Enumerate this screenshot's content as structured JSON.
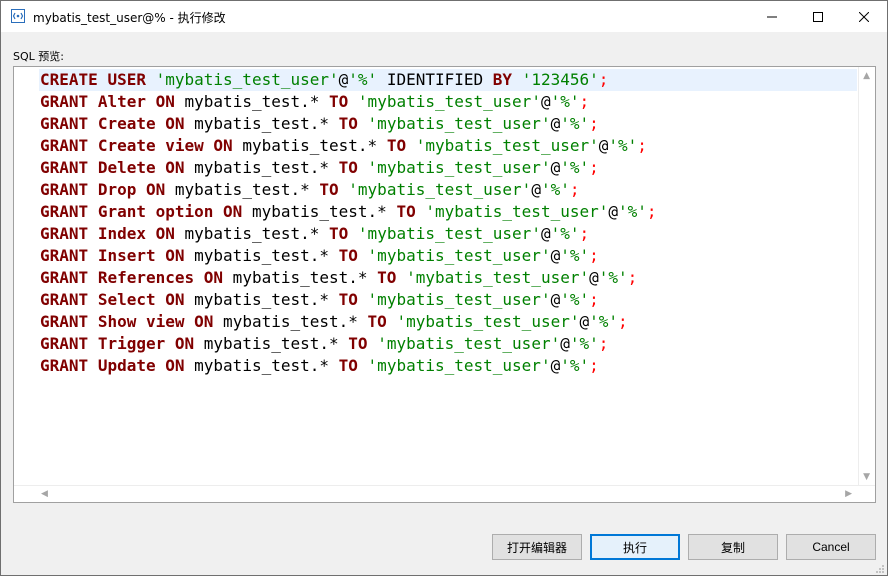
{
  "window": {
    "title": "mybatis_test_user@% - 执行修改"
  },
  "sql_preview": {
    "label": "SQL 预览:",
    "lines": [
      [
        {
          "t": "CREATE",
          "c": "kw"
        },
        {
          "t": " "
        },
        {
          "t": "USER",
          "c": "kw"
        },
        {
          "t": " "
        },
        {
          "t": "'mybatis_test_user'",
          "c": "str"
        },
        {
          "t": "@"
        },
        {
          "t": "'%'",
          "c": "str"
        },
        {
          "t": " IDENTIFIED "
        },
        {
          "t": "BY",
          "c": "kw"
        },
        {
          "t": " "
        },
        {
          "t": "'123456'",
          "c": "str"
        },
        {
          "t": ";",
          "c": "punc"
        }
      ],
      [
        {
          "t": "GRANT",
          "c": "kw"
        },
        {
          "t": " "
        },
        {
          "t": "Alter",
          "c": "kw"
        },
        {
          "t": " "
        },
        {
          "t": "ON",
          "c": "kw"
        },
        {
          "t": " mybatis_test.* "
        },
        {
          "t": "TO",
          "c": "kw"
        },
        {
          "t": " "
        },
        {
          "t": "'mybatis_test_user'",
          "c": "str"
        },
        {
          "t": "@"
        },
        {
          "t": "'%'",
          "c": "str"
        },
        {
          "t": ";",
          "c": "punc"
        }
      ],
      [
        {
          "t": "GRANT",
          "c": "kw"
        },
        {
          "t": " "
        },
        {
          "t": "Create",
          "c": "kw"
        },
        {
          "t": " "
        },
        {
          "t": "ON",
          "c": "kw"
        },
        {
          "t": " mybatis_test.* "
        },
        {
          "t": "TO",
          "c": "kw"
        },
        {
          "t": " "
        },
        {
          "t": "'mybatis_test_user'",
          "c": "str"
        },
        {
          "t": "@"
        },
        {
          "t": "'%'",
          "c": "str"
        },
        {
          "t": ";",
          "c": "punc"
        }
      ],
      [
        {
          "t": "GRANT",
          "c": "kw"
        },
        {
          "t": " "
        },
        {
          "t": "Create view",
          "c": "kw"
        },
        {
          "t": " "
        },
        {
          "t": "ON",
          "c": "kw"
        },
        {
          "t": " mybatis_test.* "
        },
        {
          "t": "TO",
          "c": "kw"
        },
        {
          "t": " "
        },
        {
          "t": "'mybatis_test_user'",
          "c": "str"
        },
        {
          "t": "@"
        },
        {
          "t": "'%'",
          "c": "str"
        },
        {
          "t": ";",
          "c": "punc"
        }
      ],
      [
        {
          "t": "GRANT",
          "c": "kw"
        },
        {
          "t": " "
        },
        {
          "t": "Delete",
          "c": "kw"
        },
        {
          "t": " "
        },
        {
          "t": "ON",
          "c": "kw"
        },
        {
          "t": " mybatis_test.* "
        },
        {
          "t": "TO",
          "c": "kw"
        },
        {
          "t": " "
        },
        {
          "t": "'mybatis_test_user'",
          "c": "str"
        },
        {
          "t": "@"
        },
        {
          "t": "'%'",
          "c": "str"
        },
        {
          "t": ";",
          "c": "punc"
        }
      ],
      [
        {
          "t": "GRANT",
          "c": "kw"
        },
        {
          "t": " "
        },
        {
          "t": "Drop",
          "c": "kw"
        },
        {
          "t": " "
        },
        {
          "t": "ON",
          "c": "kw"
        },
        {
          "t": " mybatis_test.* "
        },
        {
          "t": "TO",
          "c": "kw"
        },
        {
          "t": " "
        },
        {
          "t": "'mybatis_test_user'",
          "c": "str"
        },
        {
          "t": "@"
        },
        {
          "t": "'%'",
          "c": "str"
        },
        {
          "t": ";",
          "c": "punc"
        }
      ],
      [
        {
          "t": "GRANT",
          "c": "kw"
        },
        {
          "t": " "
        },
        {
          "t": "Grant option",
          "c": "kw"
        },
        {
          "t": " "
        },
        {
          "t": "ON",
          "c": "kw"
        },
        {
          "t": " mybatis_test.* "
        },
        {
          "t": "TO",
          "c": "kw"
        },
        {
          "t": " "
        },
        {
          "t": "'mybatis_test_user'",
          "c": "str"
        },
        {
          "t": "@"
        },
        {
          "t": "'%'",
          "c": "str"
        },
        {
          "t": ";",
          "c": "punc"
        }
      ],
      [
        {
          "t": "GRANT",
          "c": "kw"
        },
        {
          "t": " "
        },
        {
          "t": "Index",
          "c": "kw"
        },
        {
          "t": " "
        },
        {
          "t": "ON",
          "c": "kw"
        },
        {
          "t": " mybatis_test.* "
        },
        {
          "t": "TO",
          "c": "kw"
        },
        {
          "t": " "
        },
        {
          "t": "'mybatis_test_user'",
          "c": "str"
        },
        {
          "t": "@"
        },
        {
          "t": "'%'",
          "c": "str"
        },
        {
          "t": ";",
          "c": "punc"
        }
      ],
      [
        {
          "t": "GRANT",
          "c": "kw"
        },
        {
          "t": " "
        },
        {
          "t": "Insert",
          "c": "kw"
        },
        {
          "t": " "
        },
        {
          "t": "ON",
          "c": "kw"
        },
        {
          "t": " mybatis_test.* "
        },
        {
          "t": "TO",
          "c": "kw"
        },
        {
          "t": " "
        },
        {
          "t": "'mybatis_test_user'",
          "c": "str"
        },
        {
          "t": "@"
        },
        {
          "t": "'%'",
          "c": "str"
        },
        {
          "t": ";",
          "c": "punc"
        }
      ],
      [
        {
          "t": "GRANT",
          "c": "kw"
        },
        {
          "t": " "
        },
        {
          "t": "References",
          "c": "kw"
        },
        {
          "t": " "
        },
        {
          "t": "ON",
          "c": "kw"
        },
        {
          "t": " mybatis_test.* "
        },
        {
          "t": "TO",
          "c": "kw"
        },
        {
          "t": " "
        },
        {
          "t": "'mybatis_test_user'",
          "c": "str"
        },
        {
          "t": "@"
        },
        {
          "t": "'%'",
          "c": "str"
        },
        {
          "t": ";",
          "c": "punc"
        }
      ],
      [
        {
          "t": "GRANT",
          "c": "kw"
        },
        {
          "t": " "
        },
        {
          "t": "Select",
          "c": "kw"
        },
        {
          "t": " "
        },
        {
          "t": "ON",
          "c": "kw"
        },
        {
          "t": " mybatis_test.* "
        },
        {
          "t": "TO",
          "c": "kw"
        },
        {
          "t": " "
        },
        {
          "t": "'mybatis_test_user'",
          "c": "str"
        },
        {
          "t": "@"
        },
        {
          "t": "'%'",
          "c": "str"
        },
        {
          "t": ";",
          "c": "punc"
        }
      ],
      [
        {
          "t": "GRANT",
          "c": "kw"
        },
        {
          "t": " "
        },
        {
          "t": "Show view",
          "c": "kw"
        },
        {
          "t": " "
        },
        {
          "t": "ON",
          "c": "kw"
        },
        {
          "t": " mybatis_test.* "
        },
        {
          "t": "TO",
          "c": "kw"
        },
        {
          "t": " "
        },
        {
          "t": "'mybatis_test_user'",
          "c": "str"
        },
        {
          "t": "@"
        },
        {
          "t": "'%'",
          "c": "str"
        },
        {
          "t": ";",
          "c": "punc"
        }
      ],
      [
        {
          "t": "GRANT",
          "c": "kw"
        },
        {
          "t": " "
        },
        {
          "t": "Trigger",
          "c": "kw"
        },
        {
          "t": " "
        },
        {
          "t": "ON",
          "c": "kw"
        },
        {
          "t": " mybatis_test.* "
        },
        {
          "t": "TO",
          "c": "kw"
        },
        {
          "t": " "
        },
        {
          "t": "'mybatis_test_user'",
          "c": "str"
        },
        {
          "t": "@"
        },
        {
          "t": "'%'",
          "c": "str"
        },
        {
          "t": ";",
          "c": "punc"
        }
      ],
      [
        {
          "t": "GRANT",
          "c": "kw"
        },
        {
          "t": " "
        },
        {
          "t": "Update",
          "c": "kw"
        },
        {
          "t": " "
        },
        {
          "t": "ON",
          "c": "kw"
        },
        {
          "t": " mybatis_test.* "
        },
        {
          "t": "TO",
          "c": "kw"
        },
        {
          "t": " "
        },
        {
          "t": "'mybatis_test_user'",
          "c": "str"
        },
        {
          "t": "@"
        },
        {
          "t": "'%'",
          "c": "str"
        },
        {
          "t": ";",
          "c": "punc"
        }
      ]
    ]
  },
  "buttons": {
    "open_editor": "打开编辑器",
    "execute": "执行",
    "copy": "复制",
    "cancel": "Cancel"
  },
  "colors": {
    "keyword": "#800000",
    "string": "#008000",
    "punctuation": "#ff0000",
    "current_line": "#e8f2fe",
    "accent": "#0078d7"
  },
  "icons": {
    "app": "database-user-icon",
    "minimize": "minimize-icon",
    "maximize": "maximize-icon",
    "close": "close-icon"
  }
}
